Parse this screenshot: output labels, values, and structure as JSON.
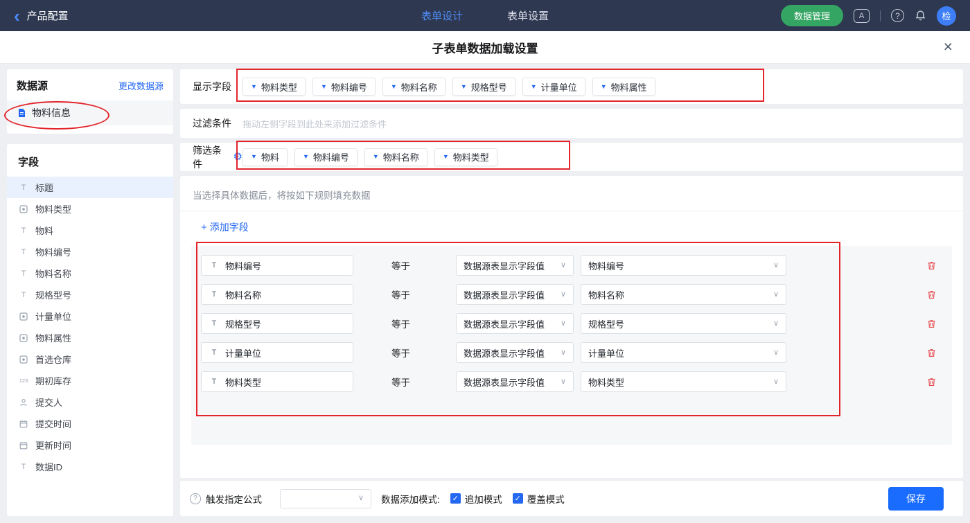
{
  "topbar": {
    "back": "产品配置",
    "tab_design": "表单设计",
    "tab_settings": "表单设置",
    "data_manage": "数据管理",
    "avatar": "检"
  },
  "dialog": {
    "title": "子表单数据加载设置"
  },
  "sidebar": {
    "datasource_title": "数据源",
    "change_datasource": "更改数据源",
    "datasource_name": "物料信息",
    "fields_title": "字段",
    "fields": [
      {
        "icon": "text-icon",
        "label": "标题"
      },
      {
        "icon": "select-icon",
        "label": "物料类型"
      },
      {
        "icon": "text-icon",
        "label": "物料"
      },
      {
        "icon": "text-icon",
        "label": "物料编号"
      },
      {
        "icon": "text-icon",
        "label": "物料名称"
      },
      {
        "icon": "text-icon",
        "label": "规格型号"
      },
      {
        "icon": "select-icon",
        "label": "计量单位"
      },
      {
        "icon": "select-icon",
        "label": "物料属性"
      },
      {
        "icon": "select-icon",
        "label": "首选仓库"
      },
      {
        "icon": "number-icon",
        "label": "期初库存"
      },
      {
        "icon": "person-icon",
        "label": "提交人"
      },
      {
        "icon": "date-icon",
        "label": "提交时间"
      },
      {
        "icon": "date-icon",
        "label": "更新时间"
      },
      {
        "icon": "text-icon",
        "label": "数据ID"
      }
    ]
  },
  "display_fields": {
    "label": "显示字段",
    "tags": [
      "物料类型",
      "物料编号",
      "物料名称",
      "规格型号",
      "计量单位",
      "物料属性"
    ]
  },
  "filter": {
    "label": "过滤条件",
    "placeholder": "拖动左侧字段到此处来添加过滤条件"
  },
  "screening": {
    "label": "筛选条件",
    "tags": [
      "物料",
      "物料编号",
      "物料名称",
      "物料类型"
    ]
  },
  "rules": {
    "hint": "当选择具体数据后，将按如下规则填充数据",
    "add_field": "添加字段",
    "rows": [
      {
        "field": "物料编号",
        "op": "等于",
        "source": "数据源表显示字段值",
        "target": "物料编号"
      },
      {
        "field": "物料名称",
        "op": "等于",
        "source": "数据源表显示字段值",
        "target": "物料名称"
      },
      {
        "field": "规格型号",
        "op": "等于",
        "source": "数据源表显示字段值",
        "target": "规格型号"
      },
      {
        "field": "计量单位",
        "op": "等于",
        "source": "数据源表显示字段值",
        "target": "计量单位"
      },
      {
        "field": "物料类型",
        "op": "等于",
        "source": "数据源表显示字段值",
        "target": "物料类型"
      }
    ]
  },
  "footer": {
    "formula_label": "触发指定公式",
    "mode_label": "数据添加模式:",
    "append_mode": "追加模式",
    "overwrite_mode": "覆盖模式",
    "save": "保存"
  },
  "colors": {
    "accent_blue": "#2468f2",
    "tab_blue": "#4e8df6",
    "brand_green": "#35a564",
    "save_blue": "#1a6cff",
    "annotation_red": "#e2252b",
    "topbar_bg": "#2e3850"
  }
}
